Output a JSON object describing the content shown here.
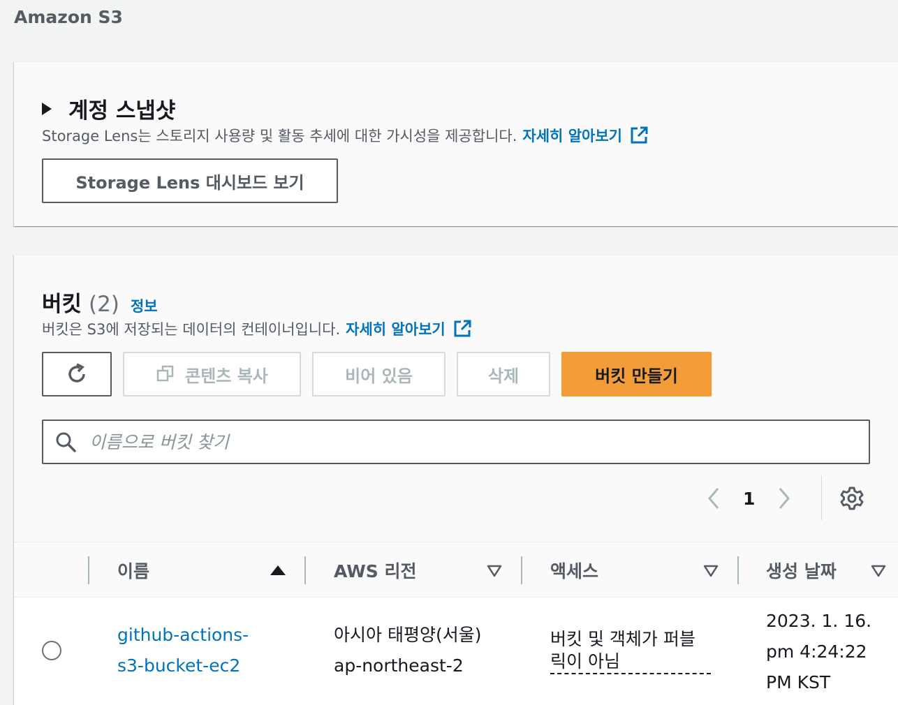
{
  "app": {
    "title": "Amazon S3"
  },
  "snapshot": {
    "title": "계정 스냅샷",
    "description": "Storage Lens는 스토리지 사용량 및 활동 추세에 대한 가시성을 제공합니다.",
    "learn_more": "자세히 알아보기",
    "dashboard_button": "Storage Lens 대시보드 보기"
  },
  "buckets": {
    "title": "버킷",
    "count": "(2)",
    "info": "정보",
    "description": "버킷은 S3에 저장되는 데이터의 컨테이너입니다.",
    "learn_more": "자세히 알아보기",
    "toolbar": {
      "copy_label": "콘텐츠 복사",
      "empty_label": "비어 있음",
      "delete_label": "삭제",
      "create_label": "버킷 만들기"
    },
    "search": {
      "placeholder": "이름으로 버킷 찾기"
    },
    "pagination": {
      "current_page": "1"
    },
    "columns": [
      "이름",
      "AWS 리전",
      "액세스",
      "생성 날짜"
    ],
    "rows": [
      {
        "name_line1": "github-actions-",
        "name_line2": "s3-bucket-ec2",
        "region_line1": "아시아 태평양(서울)",
        "region_line2": "ap-northeast-2",
        "access_line1": "버킷 및 객체가 퍼블",
        "access_line2": "릭이 아님",
        "date_line1": "2023. 1. 16.",
        "date_line2": "pm 4:24:22",
        "date_line3": "PM KST"
      }
    ]
  },
  "colors": {
    "primary_button": "#f39d38",
    "link": "#0073bb",
    "text": "#16191f",
    "muted": "#545b64"
  },
  "icons": [
    "triangle-right-icon",
    "external-link-icon",
    "refresh-icon",
    "copy-icon",
    "search-icon",
    "chevron-left-icon",
    "chevron-right-icon",
    "gear-icon",
    "sort-ascending-icon",
    "sort-descending-icon",
    "radio-icon"
  ]
}
